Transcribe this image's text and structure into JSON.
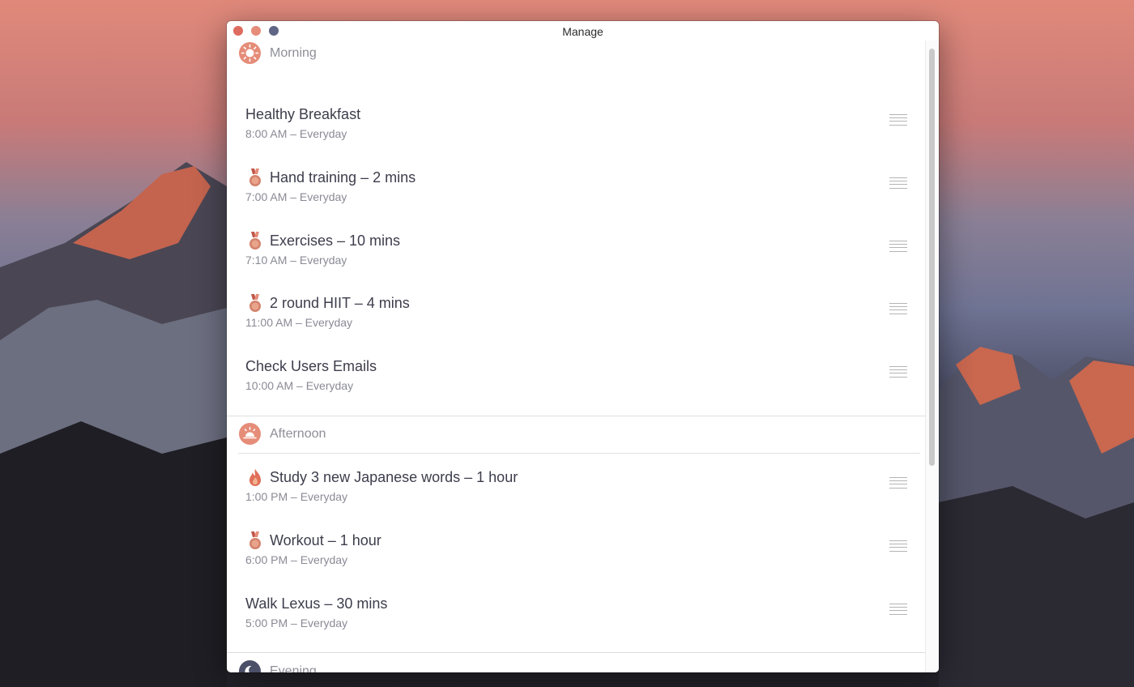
{
  "window": {
    "title": "Manage"
  },
  "colors": {
    "accent": "#e58d79",
    "evening": "#4b5068",
    "text": "#3d3d4c",
    "muted": "#8a8a96"
  },
  "sections": [
    {
      "title": "Morning",
      "icon": "sun-icon",
      "tasks": [
        {
          "title": "Healthy Breakfast",
          "subtitle": "8:00 AM – Everyday",
          "badge": null
        },
        {
          "title": "Hand training – 2 mins",
          "subtitle": "7:00 AM – Everyday",
          "badge": "medal-icon"
        },
        {
          "title": "Exercises – 10 mins",
          "subtitle": "7:10 AM – Everyday",
          "badge": "medal-icon"
        },
        {
          "title": "2 round HIIT – 4 mins",
          "subtitle": "11:00 AM – Everyday",
          "badge": "medal-icon"
        },
        {
          "title": "Check Users Emails",
          "subtitle": "10:00 AM – Everyday",
          "badge": null
        }
      ]
    },
    {
      "title": "Afternoon",
      "icon": "sunset-icon",
      "tasks": [
        {
          "title": "Study 3 new Japanese words – 1 hour",
          "subtitle": "1:00 PM – Everyday",
          "badge": "fire-icon"
        },
        {
          "title": "Workout – 1 hour",
          "subtitle": "6:00 PM – Everyday",
          "badge": "medal-icon"
        },
        {
          "title": "Walk Lexus – 30 mins",
          "subtitle": "5:00 PM – Everyday",
          "badge": null
        }
      ]
    },
    {
      "title": "Evening",
      "icon": "moon-icon",
      "tasks": []
    }
  ]
}
